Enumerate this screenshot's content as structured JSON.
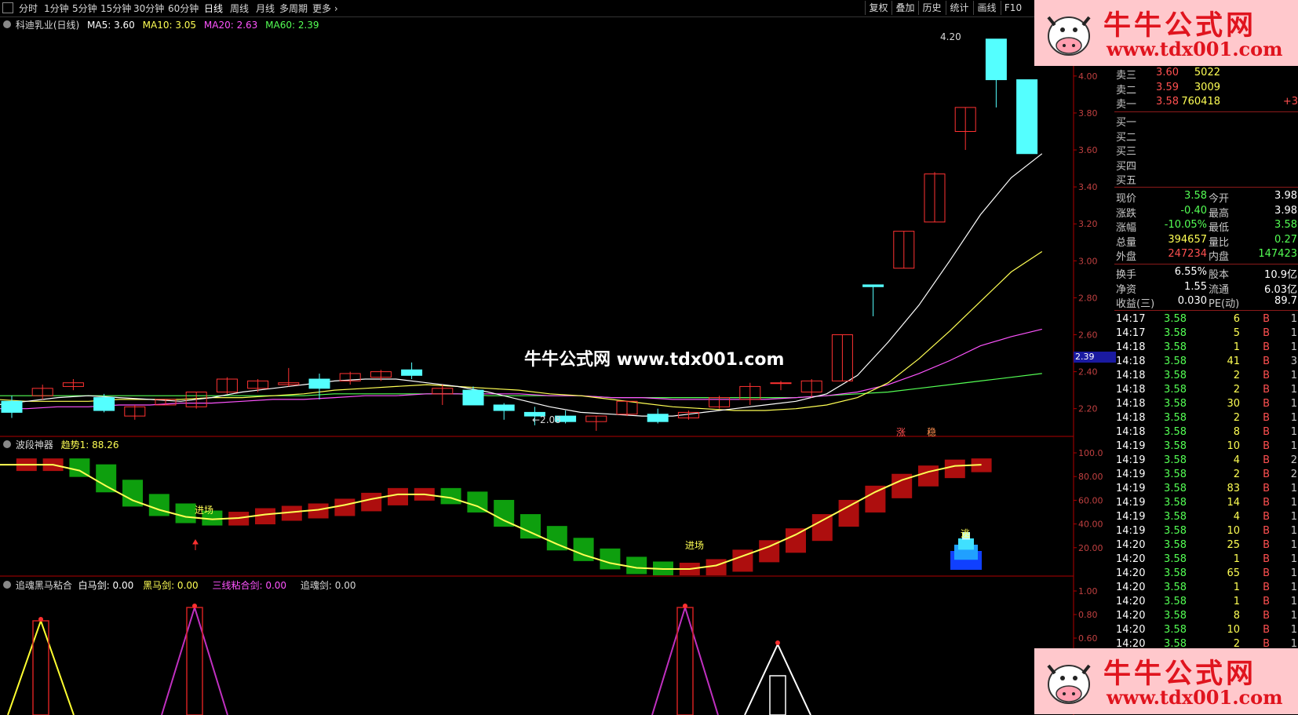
{
  "toolbar": {
    "periods": [
      "分时",
      "1分钟",
      "5分钟",
      "15分钟",
      "30分钟",
      "60分钟",
      "日线",
      "周线",
      "月线",
      "多周期",
      "更多"
    ],
    "active": "日线",
    "right_buttons": [
      "复权",
      "叠加",
      "历史",
      "统计",
      "画线",
      "F10"
    ]
  },
  "chart_header": {
    "stock": "科迪乳业(日线)",
    "ma5": "MA5: 3.60",
    "ma10": "MA10: 3.05",
    "ma20": "MA20: 2.63",
    "ma60": "MA60: 2.39"
  },
  "indicator1": {
    "name": "波段神器",
    "value": "趋势1: 88.26",
    "entry1": "进场",
    "entry2": "进场",
    "exit": "逃"
  },
  "indicator2": {
    "name": "追魂黑马粘合",
    "white": "白马剑: 0.00",
    "black": "黑马剑: 0.00",
    "three": "三线粘合剑: 0.00",
    "chase": "追魂剑: 0.00"
  },
  "annotations": {
    "high": "4.20",
    "low": "←2.08",
    "current_price_tag": "2.39",
    "zhang": "涨",
    "wen": "稳"
  },
  "watermark": {
    "brand": "牛牛公式网",
    "url": "www.tdx001.com",
    "center": "牛牛公式网 www.tdx001.com"
  },
  "colors": {
    "up": "#ff3232",
    "down": "#54ffff",
    "ma5": "#ffffff",
    "ma10": "#ffff54",
    "ma20": "#ff54ff",
    "ma60": "#54ff54",
    "axis": "#b00000"
  },
  "price_axis": [
    "4.00",
    "3.80",
    "3.60",
    "3.40",
    "3.20",
    "3.00",
    "2.80",
    "2.60",
    "2.40",
    "2.20"
  ],
  "ind1_axis": [
    "100.0",
    "80.00",
    "60.00",
    "40.00",
    "20.00"
  ],
  "ind2_axis": [
    "1.00",
    "0.80",
    "0.60"
  ],
  "chart_data": {
    "type": "candlestick",
    "ohlc": [
      [
        2.24,
        2.27,
        2.15,
        2.18
      ],
      [
        2.27,
        2.33,
        2.25,
        2.31
      ],
      [
        2.32,
        2.36,
        2.3,
        2.34
      ],
      [
        2.26,
        2.28,
        2.18,
        2.19
      ],
      [
        2.16,
        2.22,
        2.14,
        2.21
      ],
      [
        2.22,
        2.25,
        2.22,
        2.25
      ],
      [
        2.21,
        2.29,
        2.2,
        2.29
      ],
      [
        2.29,
        2.37,
        2.28,
        2.36
      ],
      [
        2.31,
        2.36,
        2.29,
        2.35
      ],
      [
        2.33,
        2.42,
        2.32,
        2.34
      ],
      [
        2.36,
        2.39,
        2.25,
        2.31
      ],
      [
        2.35,
        2.4,
        2.33,
        2.39
      ],
      [
        2.37,
        2.41,
        2.35,
        2.4
      ],
      [
        2.41,
        2.45,
        2.36,
        2.38
      ],
      [
        2.28,
        2.33,
        2.22,
        2.31
      ],
      [
        2.3,
        2.32,
        2.22,
        2.22
      ],
      [
        2.22,
        2.23,
        2.14,
        2.19
      ],
      [
        2.18,
        2.21,
        2.11,
        2.16
      ],
      [
        2.16,
        2.19,
        2.12,
        2.13
      ],
      [
        2.13,
        2.16,
        2.08,
        2.16
      ],
      [
        2.17,
        2.24,
        2.16,
        2.24
      ],
      [
        2.17,
        2.2,
        2.12,
        2.13
      ],
      [
        2.15,
        2.19,
        2.14,
        2.18
      ],
      [
        2.21,
        2.27,
        2.2,
        2.26
      ],
      [
        2.25,
        2.34,
        2.22,
        2.32
      ],
      [
        2.34,
        2.35,
        2.3,
        2.34
      ],
      [
        2.29,
        2.36,
        2.26,
        2.35
      ],
      [
        2.35,
        2.6,
        2.35,
        2.6
      ],
      [
        2.87,
        2.87,
        2.7,
        2.86
      ],
      [
        2.96,
        3.16,
        2.96,
        3.16
      ],
      [
        3.21,
        3.48,
        3.21,
        3.47
      ],
      [
        3.7,
        3.83,
        3.6,
        3.83
      ],
      [
        4.2,
        4.2,
        3.83,
        3.98
      ],
      [
        3.98,
        3.98,
        3.58,
        3.58
      ]
    ],
    "ma5": [
      2.22,
      2.24,
      2.26,
      2.27,
      2.26,
      2.25,
      2.24,
      2.26,
      2.29,
      2.31,
      2.33,
      2.35,
      2.36,
      2.36,
      2.34,
      2.32,
      2.29,
      2.25,
      2.21,
      2.18,
      2.17,
      2.16,
      2.16,
      2.18,
      2.2,
      2.22,
      2.24,
      2.28,
      2.38,
      2.56,
      2.76,
      3.0,
      3.25,
      3.45,
      3.58
    ],
    "ma10": [
      2.25,
      2.24,
      2.24,
      2.24,
      2.25,
      2.25,
      2.25,
      2.26,
      2.26,
      2.27,
      2.28,
      2.3,
      2.31,
      2.32,
      2.33,
      2.32,
      2.31,
      2.3,
      2.28,
      2.27,
      2.25,
      2.23,
      2.21,
      2.2,
      2.19,
      2.19,
      2.2,
      2.22,
      2.26,
      2.34,
      2.47,
      2.62,
      2.78,
      2.94,
      3.05
    ],
    "ma20": [
      2.2,
      2.2,
      2.21,
      2.21,
      2.22,
      2.22,
      2.23,
      2.23,
      2.24,
      2.25,
      2.25,
      2.26,
      2.27,
      2.27,
      2.28,
      2.28,
      2.28,
      2.28,
      2.27,
      2.27,
      2.26,
      2.26,
      2.25,
      2.25,
      2.25,
      2.25,
      2.26,
      2.27,
      2.29,
      2.33,
      2.39,
      2.46,
      2.54,
      2.59,
      2.63
    ],
    "ma60": [
      2.27,
      2.27,
      2.27,
      2.27,
      2.27,
      2.27,
      2.27,
      2.27,
      2.27,
      2.27,
      2.27,
      2.28,
      2.28,
      2.28,
      2.28,
      2.28,
      2.27,
      2.27,
      2.27,
      2.27,
      2.26,
      2.26,
      2.26,
      2.26,
      2.26,
      2.26,
      2.26,
      2.27,
      2.28,
      2.29,
      2.31,
      2.33,
      2.35,
      2.37,
      2.39
    ],
    "ind1": [
      90,
      90,
      90,
      85,
      72,
      60,
      52,
      46,
      44,
      45,
      48,
      50,
      52,
      56,
      61,
      65,
      65,
      62,
      55,
      43,
      33,
      23,
      14,
      7,
      3,
      2,
      2,
      5,
      13,
      21,
      31,
      43,
      55,
      67,
      77,
      84,
      89,
      90
    ],
    "ylim": [
      2.05,
      4.25
    ]
  },
  "panel": {
    "sell": [
      {
        "label": "卖三",
        "price": "3.60",
        "vol": "5022",
        "extra": ""
      },
      {
        "label": "卖二",
        "price": "3.59",
        "vol": "3009",
        "extra": ""
      },
      {
        "label": "卖一",
        "price": "3.58",
        "vol": "760418",
        "extra": "+3"
      }
    ],
    "buy": [
      "买一",
      "买二",
      "买三",
      "买四",
      "买五"
    ],
    "quote": [
      {
        "l1": "现价",
        "v1": "3.58",
        "l2": "今开",
        "v2": "3.98"
      },
      {
        "l1": "涨跌",
        "v1": "-0.40",
        "l2": "最高",
        "v2": "3.98"
      },
      {
        "l1": "涨幅",
        "v1": "-10.05%",
        "l2": "最低",
        "v2": "3.58"
      },
      {
        "l1": "总量",
        "v1": "394657",
        "l2": "量比",
        "v2": "0.27"
      },
      {
        "l1": "外盘",
        "v1": "247234",
        "l2": "内盘",
        "v2": "147423"
      }
    ],
    "fund": [
      {
        "l1": "换手",
        "v1": "6.55%",
        "l2": "股本",
        "v2": "10.9亿"
      },
      {
        "l1": "净资",
        "v1": "1.55",
        "l2": "流通",
        "v2": "6.03亿"
      },
      {
        "l1": "收益(三)",
        "v1": "0.030",
        "l2": "PE(动)",
        "v2": "89.7"
      }
    ],
    "ticks": [
      {
        "t": "14:17",
        "p": "3.58",
        "v": "6",
        "b": "B",
        "n": "1"
      },
      {
        "t": "14:17",
        "p": "3.58",
        "v": "5",
        "b": "B",
        "n": "1"
      },
      {
        "t": "14:18",
        "p": "3.58",
        "v": "1",
        "b": "B",
        "n": "1"
      },
      {
        "t": "14:18",
        "p": "3.58",
        "v": "41",
        "b": "B",
        "n": "3"
      },
      {
        "t": "14:18",
        "p": "3.58",
        "v": "2",
        "b": "B",
        "n": "1"
      },
      {
        "t": "14:18",
        "p": "3.58",
        "v": "2",
        "b": "B",
        "n": "1"
      },
      {
        "t": "14:18",
        "p": "3.58",
        "v": "30",
        "b": "B",
        "n": "1"
      },
      {
        "t": "14:18",
        "p": "3.58",
        "v": "2",
        "b": "B",
        "n": "1"
      },
      {
        "t": "14:18",
        "p": "3.58",
        "v": "8",
        "b": "B",
        "n": "1"
      },
      {
        "t": "14:19",
        "p": "3.58",
        "v": "10",
        "b": "B",
        "n": "1"
      },
      {
        "t": "14:19",
        "p": "3.58",
        "v": "4",
        "b": "B",
        "n": "2"
      },
      {
        "t": "14:19",
        "p": "3.58",
        "v": "2",
        "b": "B",
        "n": "2"
      },
      {
        "t": "14:19",
        "p": "3.58",
        "v": "83",
        "b": "B",
        "n": "1"
      },
      {
        "t": "14:19",
        "p": "3.58",
        "v": "14",
        "b": "B",
        "n": "1"
      },
      {
        "t": "14:19",
        "p": "3.58",
        "v": "4",
        "b": "B",
        "n": "1"
      },
      {
        "t": "14:19",
        "p": "3.58",
        "v": "10",
        "b": "B",
        "n": "1"
      },
      {
        "t": "14:20",
        "p": "3.58",
        "v": "25",
        "b": "B",
        "n": "1"
      },
      {
        "t": "14:20",
        "p": "3.58",
        "v": "1",
        "b": "B",
        "n": "1"
      },
      {
        "t": "14:20",
        "p": "3.58",
        "v": "65",
        "b": "B",
        "n": "1"
      },
      {
        "t": "14:20",
        "p": "3.58",
        "v": "1",
        "b": "B",
        "n": "1"
      },
      {
        "t": "14:20",
        "p": "3.58",
        "v": "1",
        "b": "B",
        "n": "1"
      },
      {
        "t": "14:20",
        "p": "3.58",
        "v": "8",
        "b": "B",
        "n": "1"
      },
      {
        "t": "14:20",
        "p": "3.58",
        "v": "10",
        "b": "B",
        "n": "1"
      },
      {
        "t": "14:20",
        "p": "3.58",
        "v": "2",
        "b": "B",
        "n": "1"
      }
    ]
  }
}
